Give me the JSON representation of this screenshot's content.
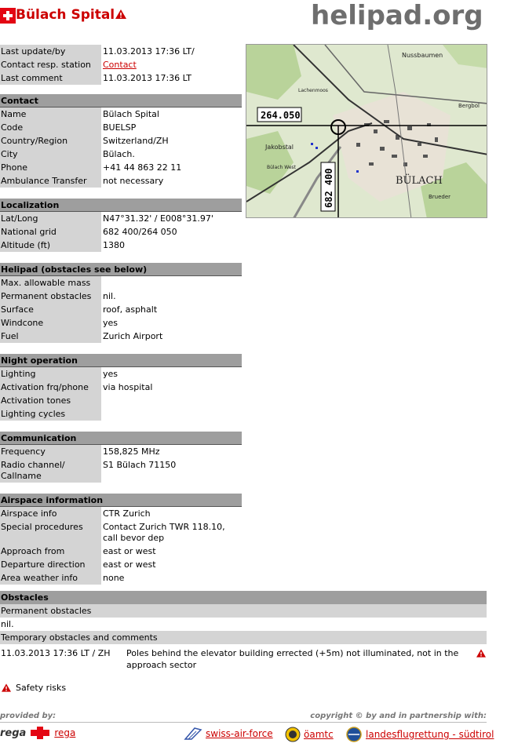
{
  "header": {
    "title": "Bülach Spital",
    "logo": "helipad.org"
  },
  "status": {
    "last_update_label": "Last update/by",
    "last_update_value": "11.03.2013 17:36 LT/",
    "contact_resp_label": "Contact resp. station",
    "contact_resp_link": "Contact",
    "last_comment_label": "Last comment",
    "last_comment_value": "11.03.2013 17:36 LT"
  },
  "contact": {
    "title": "Contact",
    "rows": [
      {
        "label": "Name",
        "value": "Bülach Spital"
      },
      {
        "label": "Code",
        "value": "BUELSP"
      },
      {
        "label": "Country/Region",
        "value": "Switzerland/ZH"
      },
      {
        "label": "City",
        "value": "Bülach."
      },
      {
        "label": "Phone",
        "value": "+41 44 863 22 11"
      },
      {
        "label": "Ambulance Transfer",
        "value": "not necessary"
      }
    ]
  },
  "localization": {
    "title": "Localization",
    "rows": [
      {
        "label": "Lat/Long",
        "value": "N47°31.32' / E008°31.97'"
      },
      {
        "label": "National grid",
        "value": "682 400/264 050"
      },
      {
        "label": "Altitude (ft)",
        "value": "1380"
      }
    ]
  },
  "helipad": {
    "title": "Helipad (obstacles see below)",
    "rows": [
      {
        "label": "Max. allowable mass",
        "value": ""
      },
      {
        "label": "Permanent obstacles",
        "value": "nil."
      },
      {
        "label": "Surface",
        "value": "roof, asphalt"
      },
      {
        "label": "Windcone",
        "value": "yes"
      },
      {
        "label": "Fuel",
        "value": "Zurich Airport"
      }
    ]
  },
  "night": {
    "title": "Night operation",
    "rows": [
      {
        "label": "Lighting",
        "value": "yes"
      },
      {
        "label": "Activation frq/phone",
        "value": "via hospital"
      },
      {
        "label": "Activation tones",
        "value": ""
      },
      {
        "label": "Lighting cycles",
        "value": ""
      }
    ]
  },
  "communication": {
    "title": "Communication",
    "rows": [
      {
        "label": "Frequency",
        "value": "158,825 MHz"
      },
      {
        "label": "Radio channel/ Callname",
        "value": "S1 Bülach 71150"
      }
    ]
  },
  "airspace": {
    "title": "Airspace information",
    "rows": [
      {
        "label": "Airspace info",
        "value": "CTR Zurich"
      },
      {
        "label": "Special procedures",
        "value": "Contact Zurich TWR 118.10, call bevor dep"
      },
      {
        "label": "Approach from",
        "value": "east or west"
      },
      {
        "label": "Departure direction",
        "value": "east or west"
      },
      {
        "label": "Area weather info",
        "value": "none"
      }
    ]
  },
  "map": {
    "grid_north": "264.050",
    "grid_east": "682 400",
    "town_label": "BÜLACH",
    "labels": [
      "Nussbaumen",
      "Jakobstal",
      "Bülach West",
      "Bergbol",
      "Brueder",
      "Lachenmoos"
    ]
  },
  "obstacles": {
    "title": "Obstacles",
    "permanent_label": "Permanent obstacles",
    "permanent_value": "nil.",
    "temporary_label": "Temporary obstacles and comments",
    "temporary_when": "11.03.2013 17:36 LT / ZH",
    "temporary_desc": "Poles behind the elevator building errected (+5m) not illuminated, not in the approach sector"
  },
  "safety": {
    "label": "Safety risks"
  },
  "footer": {
    "provided_by": "provided by:",
    "copyright": "copyright © by and in partnership with:",
    "rega_word": "rega",
    "rega_link": "rega",
    "swiss_air_force": "swiss-air-force",
    "oamtc": "öamtc",
    "landesflugrettung": "landesflugrettung - südtirol"
  },
  "colors": {
    "accent_red": "#cc0000",
    "section_grey": "#9e9e9e",
    "label_grey": "#d4d4d4"
  }
}
